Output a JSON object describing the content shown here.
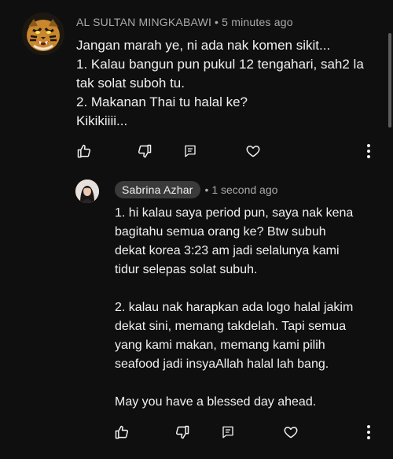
{
  "comment": {
    "author": "AL SULTAN MINGKABAWI",
    "separator": "•",
    "time": "5 minutes ago",
    "lines": [
      "Jangan marah ye, ni ada nak komen sikit...",
      "1. Kalau bangun pun pukul 12 tengahari, sah2 la",
      "tak solat suboh tu.",
      "2. Makanan Thai tu halal ke?",
      "Kikikiiii..."
    ],
    "avatar_icon": "tiger-avatar"
  },
  "reply": {
    "author": "Sabrina Azhar",
    "separator": "•",
    "time": "1 second ago",
    "paragraphs": [
      [
        "1. hi kalau saya period pun, saya nak kena",
        "bagitahu semua orang ke? Btw subuh",
        "dekat korea 3:23 am jadi selalunya kami",
        "tidur selepas solat subuh."
      ],
      [
        "2. kalau nak harapkan ada logo halal jakim",
        "dekat sini, memang takdelah. Tapi semua",
        "yang kami makan, memang kami pilih",
        "seafood jadi insyaAllah halal lah bang."
      ],
      [
        "May you have a blessed day ahead."
      ]
    ],
    "avatar_icon": "user-photo-avatar"
  },
  "actions": {
    "icons": [
      "thumbs-up-icon",
      "thumbs-down-icon",
      "reply-icon",
      "heart-icon",
      "more-vertical-icon"
    ]
  },
  "colors": {
    "background": "#0f0f0f",
    "text": "#f1f1f1",
    "secondary_text": "#aaaaaa",
    "chip": "#3a3a3a"
  }
}
